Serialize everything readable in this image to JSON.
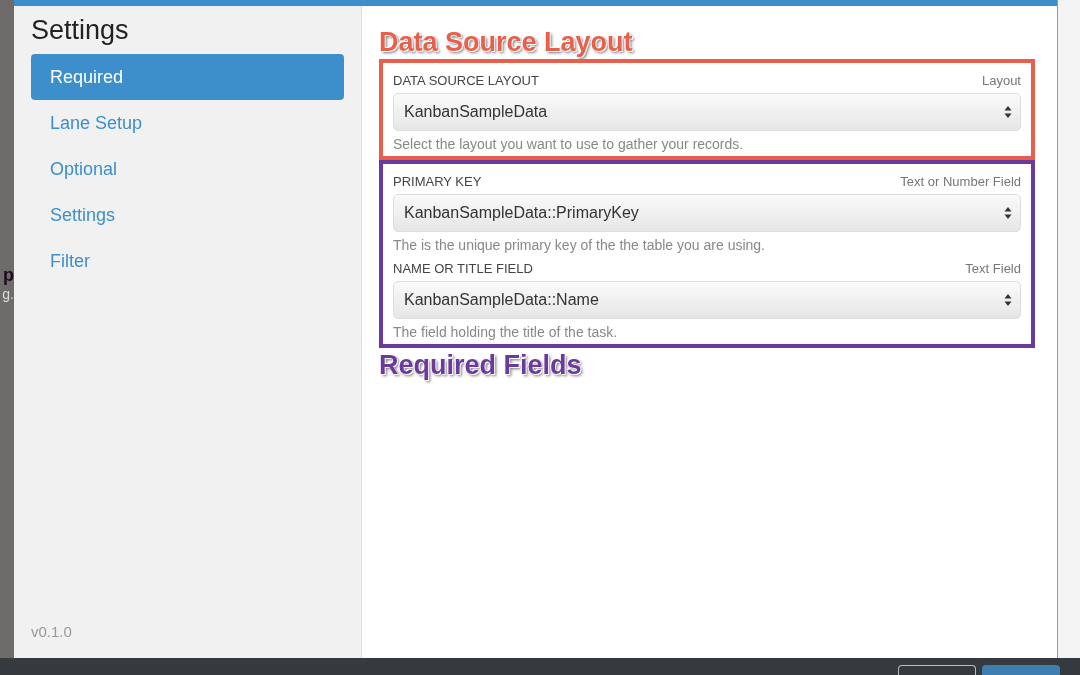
{
  "background_fragments": [
    "p",
    "g."
  ],
  "sidebar": {
    "title": "Settings",
    "items": [
      {
        "label": "Required",
        "selected": true
      },
      {
        "label": "Lane Setup",
        "selected": false
      },
      {
        "label": "Optional",
        "selected": false
      },
      {
        "label": "Settings",
        "selected": false
      },
      {
        "label": "Filter",
        "selected": false
      }
    ],
    "version": "v0.1.0"
  },
  "annotations": [
    {
      "label": "Data Source Layout",
      "color": "#e8604c",
      "label_above": true,
      "fields": [
        {
          "label": "DATA SOURCE LAYOUT",
          "type": "Layout",
          "value": "KanbanSampleData",
          "help": "Select the layout you want to use to gather your records."
        }
      ]
    },
    {
      "label": "Required Fields",
      "color": "#6a3a9c",
      "label_above": false,
      "fields": [
        {
          "label": "PRIMARY KEY",
          "type": "Text or Number Field",
          "value": "KanbanSampleData::PrimaryKey",
          "help": "The is the unique primary key of the the table you are using."
        },
        {
          "label": "NAME OR TITLE FIELD",
          "type": "Text Field",
          "value": "KanbanSampleData::Name",
          "help": "The field holding the title of the task."
        }
      ]
    }
  ]
}
